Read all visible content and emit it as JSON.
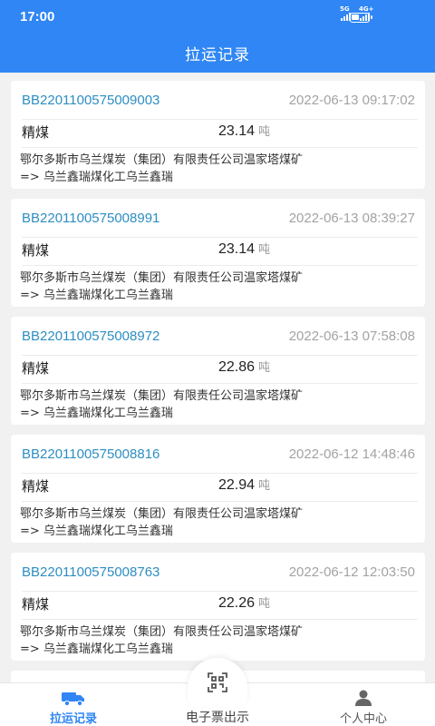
{
  "status_bar": {
    "time": "17:00",
    "net1": "5G",
    "net2": "4G+",
    "battery_level": 0.45
  },
  "header": {
    "title": "拉运记录"
  },
  "records": [
    {
      "no": "BB2201100575009003",
      "time": "2022-06-13 09:17:02",
      "kind": "精煤",
      "weight": "23.14",
      "unit": "吨",
      "route_line1": "鄂尔多斯市乌兰煤炭（集团）有限责任公司温家塔煤矿",
      "route_line2": "=> 乌兰鑫瑞煤化工乌兰鑫瑞"
    },
    {
      "no": "BB2201100575008991",
      "time": "2022-06-13 08:39:27",
      "kind": "精煤",
      "weight": "23.14",
      "unit": "吨",
      "route_line1": "鄂尔多斯市乌兰煤炭（集团）有限责任公司温家塔煤矿",
      "route_line2": "=> 乌兰鑫瑞煤化工乌兰鑫瑞"
    },
    {
      "no": "BB2201100575008972",
      "time": "2022-06-13 07:58:08",
      "kind": "精煤",
      "weight": "22.86",
      "unit": "吨",
      "route_line1": "鄂尔多斯市乌兰煤炭（集团）有限责任公司温家塔煤矿",
      "route_line2": "=> 乌兰鑫瑞煤化工乌兰鑫瑞"
    },
    {
      "no": "BB2201100575008816",
      "time": "2022-06-12 14:48:46",
      "kind": "精煤",
      "weight": "22.94",
      "unit": "吨",
      "route_line1": "鄂尔多斯市乌兰煤炭（集团）有限责任公司温家塔煤矿",
      "route_line2": "=> 乌兰鑫瑞煤化工乌兰鑫瑞"
    },
    {
      "no": "BB2201100575008763",
      "time": "2022-06-12 12:03:50",
      "kind": "精煤",
      "weight": "22.26",
      "unit": "吨",
      "route_line1": "鄂尔多斯市乌兰煤炭（集团）有限责任公司温家塔煤矿",
      "route_line2": "=> 乌兰鑫瑞煤化工乌兰鑫瑞"
    }
  ],
  "tabbar": {
    "tabs": [
      {
        "label": "拉运记录",
        "icon": "truck-icon",
        "active": true
      },
      {
        "label": "电子票出示",
        "icon": "qr-scan-icon",
        "active": false
      },
      {
        "label": "个人中心",
        "icon": "person-icon",
        "active": false
      }
    ]
  },
  "colors": {
    "primary": "#2f86f4",
    "record_no": "#2d8ec2",
    "muted": "#a3a3a3",
    "background": "#f1f1f1"
  }
}
